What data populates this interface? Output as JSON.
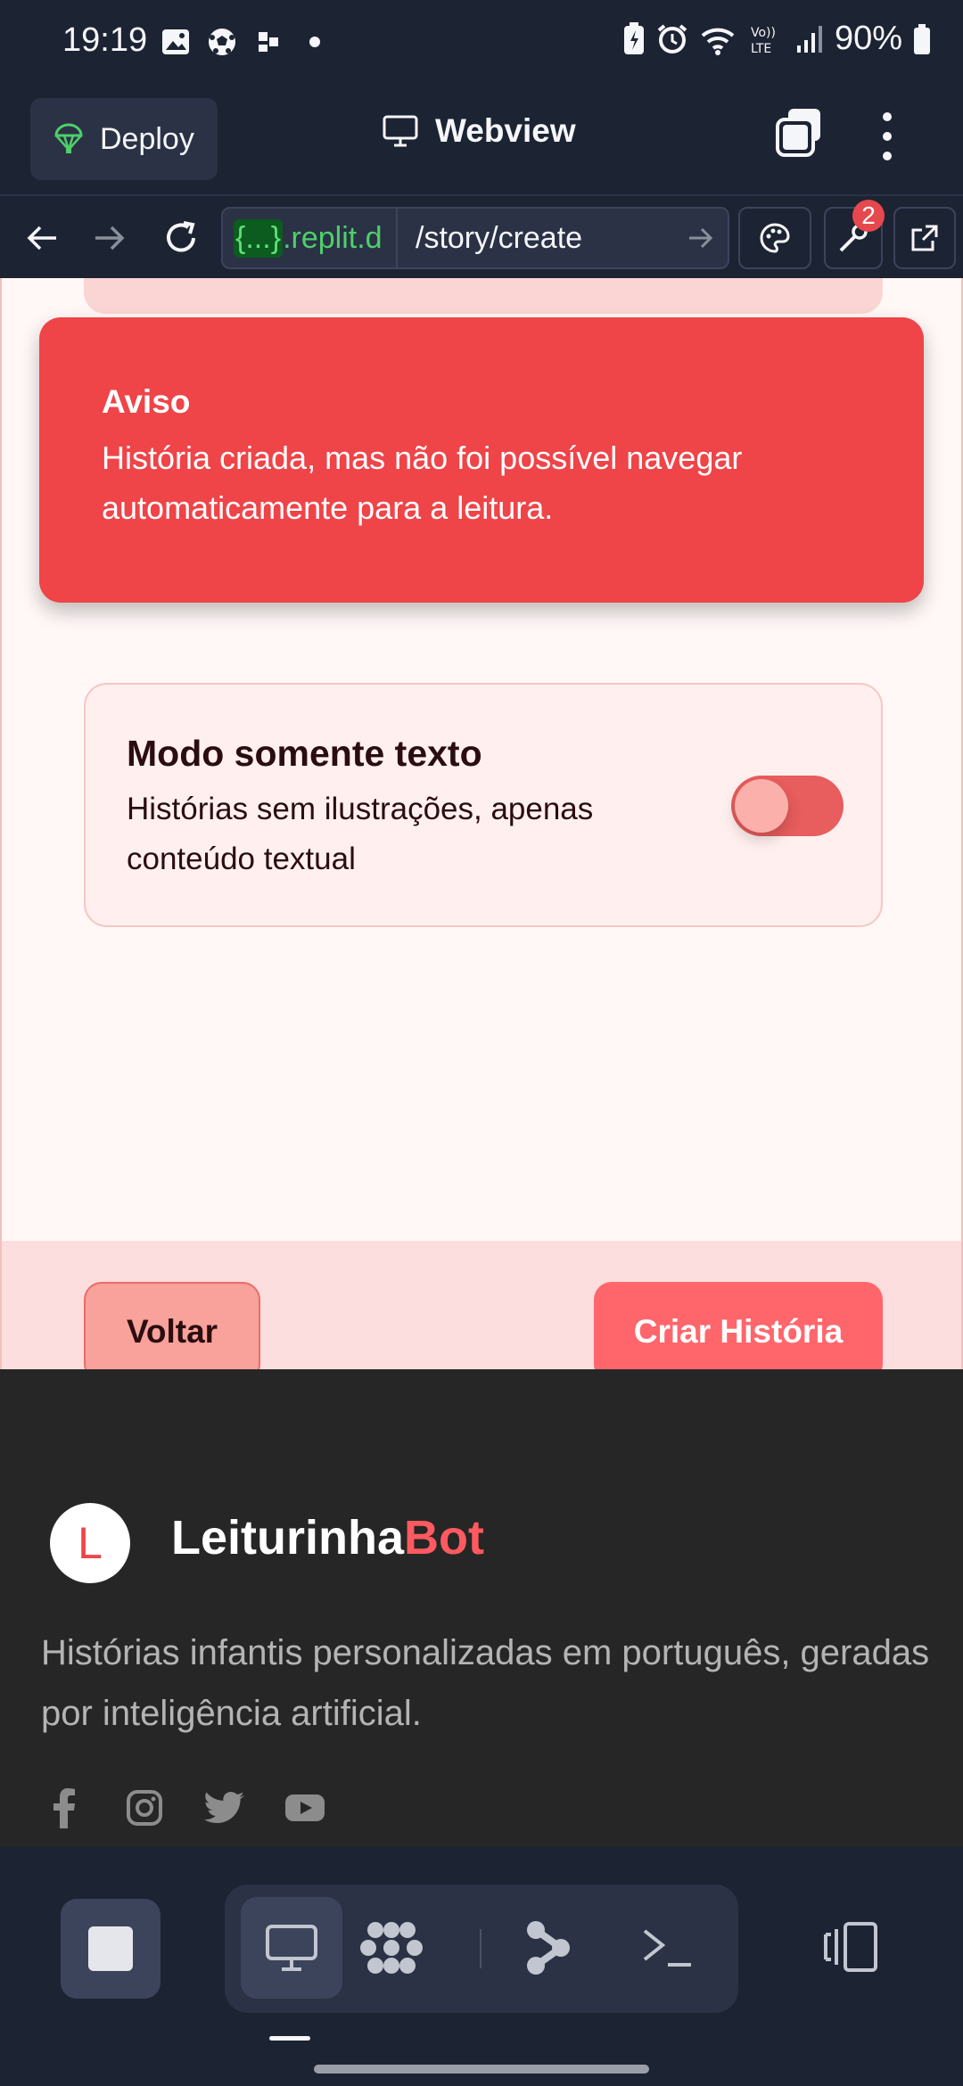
{
  "status_bar": {
    "time": "19:19",
    "battery": "90%",
    "left_icons": [
      "gallery-icon",
      "soccer-ball-icon",
      "app-icon",
      "dot-icon"
    ],
    "right_icons": [
      "battery-saver-icon",
      "alarm-icon",
      "wifi-icon",
      "volte-icon",
      "signal-icon",
      "battery-icon"
    ]
  },
  "header": {
    "deploy_label": "Deploy",
    "title": "Webview"
  },
  "urlbar": {
    "host_braces": "{...}",
    "host_rest": ".replit.d",
    "path": "/story/create",
    "notification_count": "2"
  },
  "toast": {
    "title": "Aviso",
    "message": "História criada, mas não foi possível navegar automaticamente para a leitura."
  },
  "text_mode": {
    "title": "Modo somente texto",
    "description": "Histórias sem ilustrações, apenas conteúdo textual",
    "enabled": false
  },
  "actions": {
    "back_label": "Voltar",
    "create_label": "Criar História"
  },
  "site_footer": {
    "logo_letter": "L",
    "brand_primary": "Leiturinha",
    "brand_accent": "Bot",
    "description": "Histórias infantis personalizadas em português, geradas por inteligência artificial.",
    "socials": [
      "facebook-icon",
      "instagram-icon",
      "twitter-icon",
      "youtube-icon"
    ]
  },
  "colors": {
    "ide_background": "#1c2333",
    "toast": "#ef4448",
    "primary_button": "#ff666b",
    "page_background": "#f8a5a0",
    "footer_background": "#262626",
    "brand_accent": "#ff5a5f"
  }
}
